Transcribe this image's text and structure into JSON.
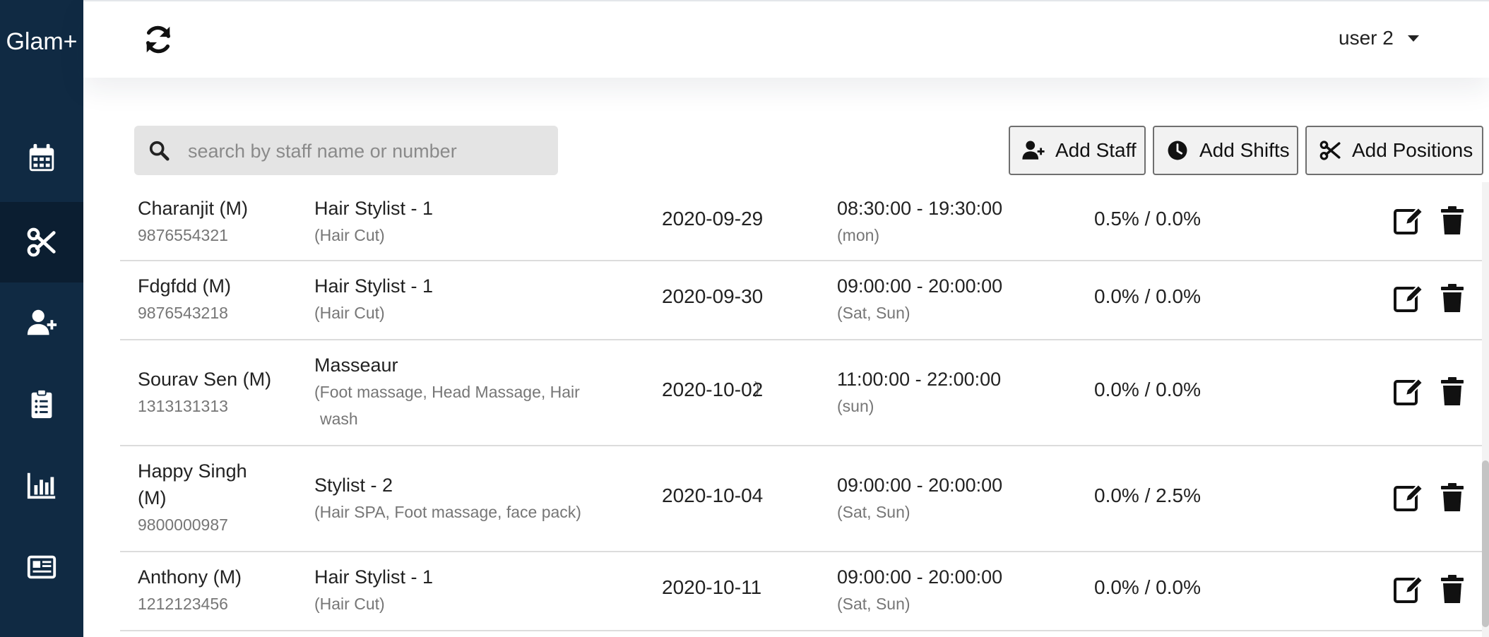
{
  "app": {
    "brand": "Glam+",
    "user": "user 2"
  },
  "sidebar": {
    "items": [
      {
        "icon": "calendar-icon",
        "active": false
      },
      {
        "icon": "scissors-icon",
        "active": true
      },
      {
        "icon": "user-plus-icon",
        "active": false
      },
      {
        "icon": "clipboard-list-icon",
        "active": false
      },
      {
        "icon": "bar-chart-icon",
        "active": false
      },
      {
        "icon": "newspaper-icon",
        "active": false
      }
    ]
  },
  "search": {
    "placeholder": "search by staff name or number",
    "value": ""
  },
  "toolbar": {
    "add_staff": "Add Staff",
    "add_shifts": "Add Shifts",
    "add_positions": "Add Positions"
  },
  "staff": [
    {
      "name": "Charanjit (M)",
      "phone": "9876554321",
      "position": "Hair Stylist - 1",
      "services": "(Hair Cut)",
      "date": "2020-09-29",
      "shift": "08:30:00 - 19:30:00",
      "days": "(mon)",
      "commission": "0.5% / 0.0%"
    },
    {
      "name": "Fdgfdd (M)",
      "phone": "9876543218",
      "position": "Hair Stylist - 1",
      "services": "(Hair Cut)",
      "date": "2020-09-30",
      "shift": "09:00:00 - 20:00:00",
      "days": "(Sat, Sun)",
      "commission": "0.0% / 0.0%"
    },
    {
      "name": "Sourav Sen (M)",
      "phone": "1313131313",
      "position": "Masseaur",
      "services_line1": "(Foot massage, Head Massage, Hair",
      "services_line2": "wash",
      "services_close": ")",
      "date": "2020-10-02",
      "shift": "11:00:00 - 22:00:00",
      "days": "(sun)",
      "commission": "0.0% / 0.0%"
    },
    {
      "name_line1": "Happy Singh",
      "name_line2": "(M)",
      "phone": "9800000987",
      "position": "Stylist - 2",
      "services": "(Hair SPA, Foot massage, face pack)",
      "date": "2020-10-04",
      "shift": "09:00:00 - 20:00:00",
      "days": "(Sat, Sun)",
      "commission": "0.0% / 2.5%"
    },
    {
      "name": "Anthony (M)",
      "phone": "1212123456",
      "position": "Hair Stylist - 1",
      "services": "(Hair Cut)",
      "date": "2020-10-11",
      "shift": "09:00:00 - 20:00:00",
      "days": "(Sat, Sun)",
      "commission": "0.0% / 0.0%"
    }
  ]
}
